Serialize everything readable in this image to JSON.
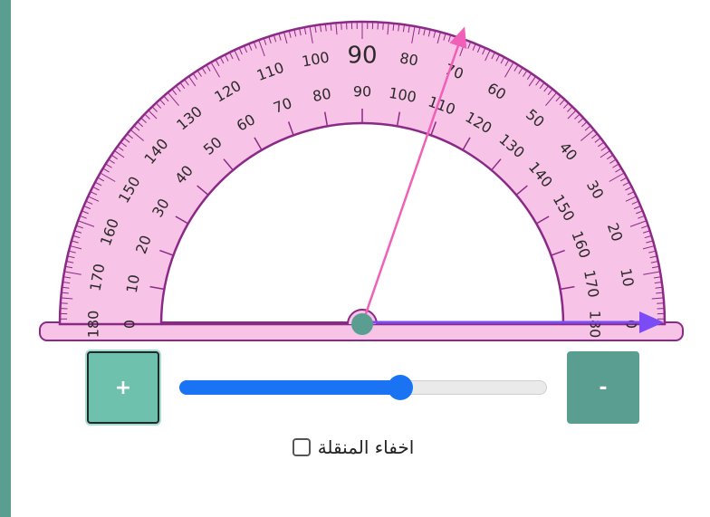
{
  "protractor": {
    "outer_labels": [
      "0",
      "10",
      "20",
      "30",
      "40",
      "50",
      "60",
      "70",
      "80",
      "90",
      "100",
      "110",
      "120",
      "130",
      "140",
      "150",
      "160",
      "170",
      "180"
    ],
    "inner_labels": [
      "180",
      "170",
      "160",
      "150",
      "140",
      "130",
      "120",
      "110",
      "100",
      "90",
      "80",
      "70",
      "60",
      "50",
      "40",
      "30",
      "20",
      "10",
      "0"
    ],
    "base_color": "#f7c3e6",
    "outline_color": "#8b2a86",
    "angle_degrees": 71,
    "arm_color": "#f05fb8",
    "baseline_color": "#7b4cf5",
    "center_color": "#5a9e92"
  },
  "controls": {
    "plus_label": "+",
    "minus_label": "-",
    "slider_level": 0.6,
    "slider_color": "#1a73f2"
  },
  "hide_option": {
    "label": "اخفاء المنقلة",
    "checked": false
  }
}
